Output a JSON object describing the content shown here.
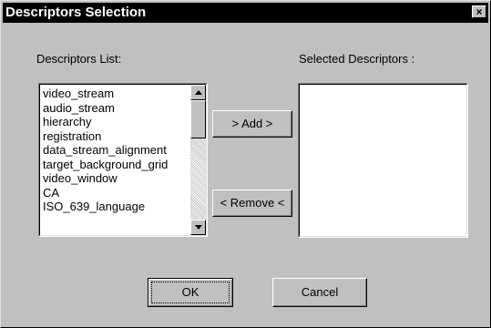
{
  "window": {
    "title": "Descriptors Selection",
    "close_glyph": "×"
  },
  "left": {
    "label": "Descriptors List:",
    "items": [
      "video_stream",
      "audio_stream",
      "hierarchy",
      "registration",
      "data_stream_alignment",
      "target_background_grid",
      "video_window",
      "CA",
      "ISO_639_language"
    ]
  },
  "right": {
    "label": "Selected Descriptors :",
    "items": []
  },
  "buttons": {
    "add": "> Add >",
    "remove": "< Remove <",
    "ok": "OK",
    "cancel": "Cancel"
  },
  "icons": {
    "close": "close-icon",
    "scroll_up": "scroll-up-arrow-icon",
    "scroll_down": "scroll-down-arrow-icon"
  },
  "colors": {
    "titlebar": "#000000",
    "face": "#c0c0c0",
    "list_bg": "#ffffff"
  }
}
